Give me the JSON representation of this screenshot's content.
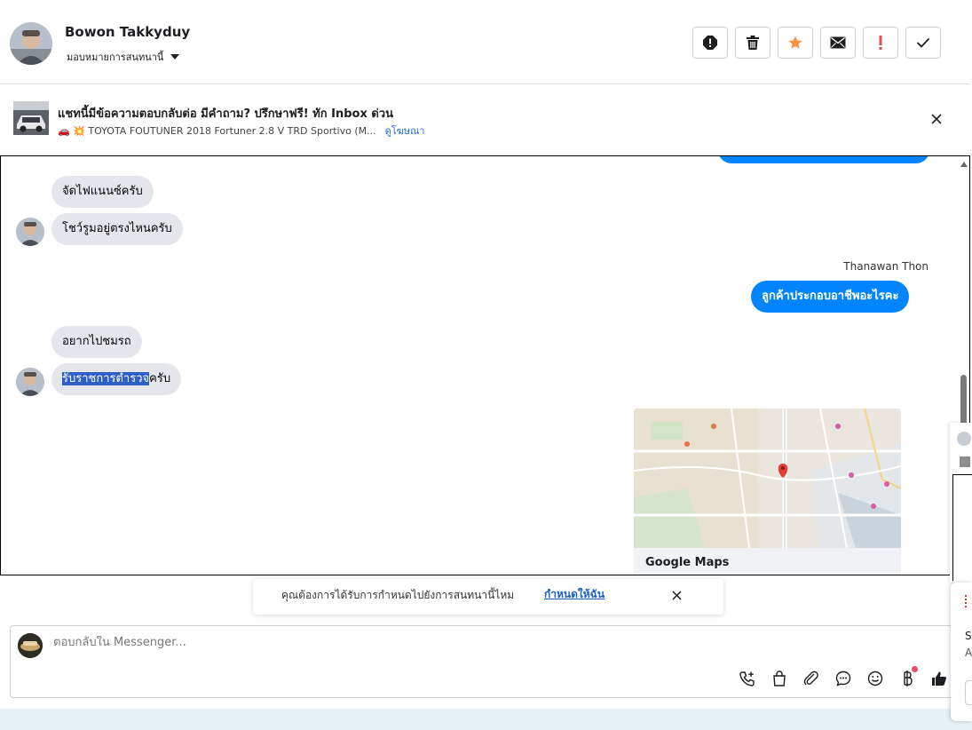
{
  "header": {
    "name": "Bowon Takkyduy",
    "assign_label": "มอบหมายการสนทนานี้",
    "actions": [
      "spam-icon",
      "trash-icon",
      "star-icon",
      "mail-icon",
      "important-icon",
      "check-icon"
    ]
  },
  "ad": {
    "title": "แชทนี้มีข้อความตอบกลับต่อ มีคำถาม? ปรึกษาฟรี! ทัก Inbox ด่วน",
    "subtitle": "🚗 💥 TOYOTA FOUTUNER 2018 Fortuner 2.8 V TRD Sportivo (M...",
    "link": "ดูโฆษณา"
  },
  "thread": {
    "incoming_1": [
      "จัดไฟแนนซ์ครับ",
      "โชว์รูมอยู่ตรงไหนครับ"
    ],
    "sender_name": "Thanawan Thon",
    "outgoing_1": "ลูกค้าประกอบอาชีพอะไรคะ",
    "incoming_2_first": "อยากไปชมรถ",
    "incoming_2_selected": "รับราชการตำรวจ",
    "incoming_2_rest": "ครับ",
    "map_caption": "Google Maps"
  },
  "notify": {
    "text": "คุณต้องการได้รับการกำหนดไปยังการสนทนานี้ไหม",
    "link": "กำหนดให้ฉัน"
  },
  "composer": {
    "placeholder": "ตอบกลับใน Messenger...",
    "value": ""
  },
  "side_panel": {
    "line1": "S",
    "line2": "A"
  },
  "colors": {
    "messenger_blue": "#0084ff",
    "incoming_bubble": "#e4e6eb",
    "star_orange": "#f7923a",
    "important_red": "#d9534f",
    "link_blue": "#216fdb"
  }
}
